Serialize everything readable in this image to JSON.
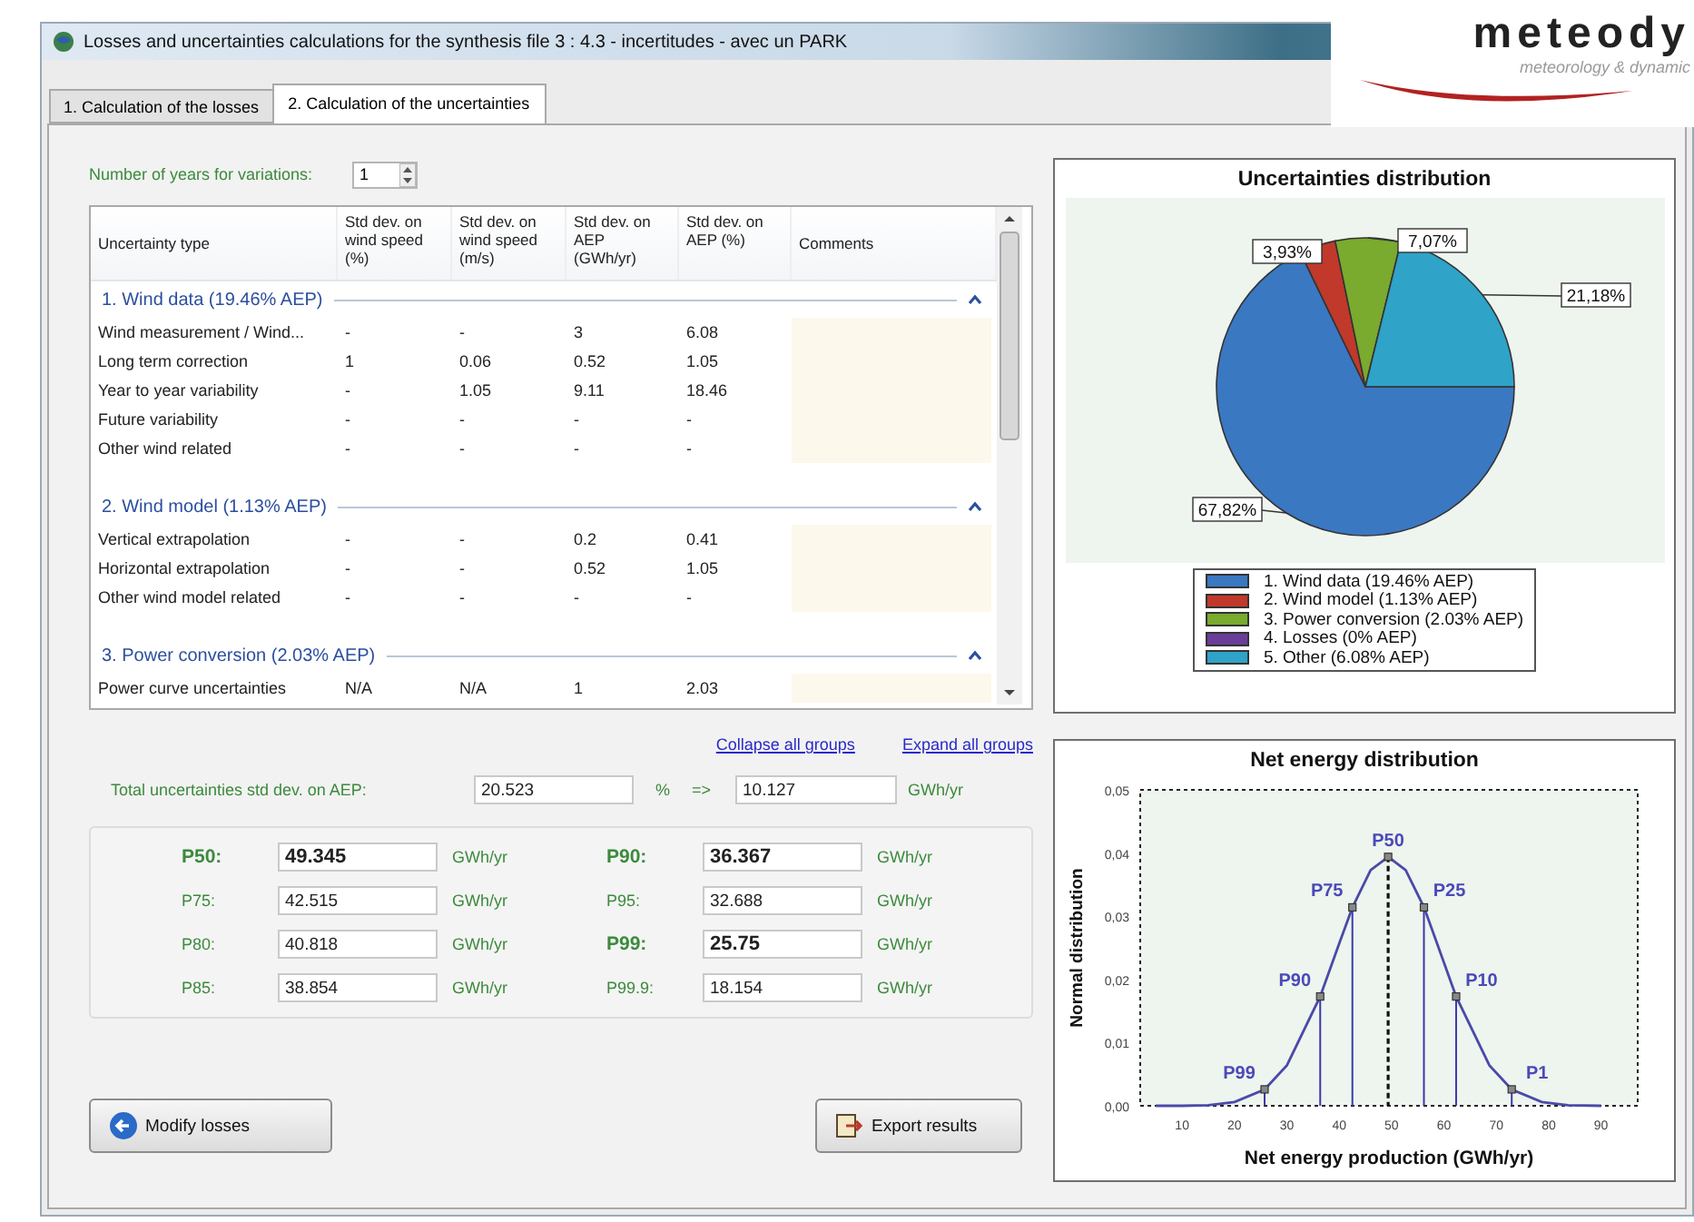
{
  "window": {
    "title": "Losses and uncertainties calculations for the synthesis file 3 : 4.3 - incertitudes - avec un PARK"
  },
  "logo": {
    "name": "meteody",
    "tagline": "meteorology & dynamic"
  },
  "tabs": [
    {
      "label": "1. Calculation of the losses",
      "selected": false
    },
    {
      "label": "2. Calculation of the uncertainties",
      "selected": true
    }
  ],
  "years": {
    "label": "Number of years for variations:",
    "value": "1"
  },
  "table": {
    "columns": [
      "Uncertainty type",
      "Std dev. on wind speed (%)",
      "Std dev. on wind speed (m/s)",
      "Std dev. on AEP (GWh/yr)",
      "Std dev. on AEP (%)",
      "Comments"
    ],
    "groups": [
      {
        "title": "1. Wind data (19.46% AEP)",
        "expanded": true,
        "rows": [
          [
            "Wind measurement / Wind...",
            "-",
            "-",
            "3",
            "6.08"
          ],
          [
            "Long term correction",
            "1",
            "0.06",
            "0.52",
            "1.05"
          ],
          [
            "Year to year variability",
            "-",
            "1.05",
            "9.11",
            "18.46"
          ],
          [
            "Future variability",
            "-",
            "-",
            "-",
            "-"
          ],
          [
            "Other wind related",
            "-",
            "-",
            "-",
            "-"
          ]
        ]
      },
      {
        "title": "2. Wind model (1.13% AEP)",
        "expanded": true,
        "rows": [
          [
            "Vertical extrapolation",
            "-",
            "-",
            "0.2",
            "0.41"
          ],
          [
            "Horizontal extrapolation",
            "-",
            "-",
            "0.52",
            "1.05"
          ],
          [
            "Other wind model related",
            "-",
            "-",
            "-",
            "-"
          ]
        ]
      },
      {
        "title": "3. Power conversion (2.03% AEP)",
        "expanded": true,
        "rows": [
          [
            "Power curve uncertainties",
            "N/A",
            "N/A",
            "1",
            "2.03"
          ]
        ]
      }
    ]
  },
  "links": [
    "Collapse all groups",
    "Expand all groups"
  ],
  "total": {
    "label": "Total uncertainties std dev. on AEP:",
    "percent": "20.523",
    "percent_unit": "%",
    "arrow": "=>",
    "value": "10.127",
    "unit": "GWh/yr"
  },
  "percentiles": [
    {
      "label": "P50:",
      "value": "49.345",
      "unit": "GWh/yr",
      "emphasized": true
    },
    {
      "label": "P90:",
      "value": "36.367",
      "unit": "GWh/yr",
      "emphasized": true
    },
    {
      "label": "P75:",
      "value": "42.515",
      "unit": "GWh/yr",
      "emphasized": false
    },
    {
      "label": "P95:",
      "value": "32.688",
      "unit": "GWh/yr",
      "emphasized": false
    },
    {
      "label": "P80:",
      "value": "40.818",
      "unit": "GWh/yr",
      "emphasized": false
    },
    {
      "label": "P99:",
      "value": "25.75",
      "unit": "GWh/yr",
      "emphasized": true
    },
    {
      "label": "P85:",
      "value": "38.854",
      "unit": "GWh/yr",
      "emphasized": false
    },
    {
      "label": "P99.9:",
      "value": "18.154",
      "unit": "GWh/yr",
      "emphasized": false
    }
  ],
  "buttons": [
    {
      "label": "Modify losses",
      "kind": "back"
    },
    {
      "label": "Export results",
      "kind": "export"
    }
  ],
  "pie_panel": {
    "chart_data": {
      "type": "pie",
      "title": "Uncertainties distribution",
      "categories": [
        "1. Wind data (19.46% AEP)",
        "2. Wind model (1.13% AEP)",
        "3. Power conversion (2.03% AEP)",
        "4. Losses (0% AEP)",
        "5. Other (6.08% AEP)"
      ],
      "values": [
        67.82,
        3.93,
        7.07,
        0,
        21.18
      ],
      "colors": [
        "#3a78c2",
        "#c0392b",
        "#7aaa2e",
        "#6a3d9a",
        "#2fa3c8"
      ],
      "value_labels": [
        "67,82%",
        "3,93%",
        "7,07%",
        null,
        "21,18%"
      ]
    }
  },
  "distribution_panel": {
    "chart_data": {
      "type": "line",
      "title": "Net energy distribution",
      "xlabel": "Net energy production (GWh/yr)",
      "ylabel": "Normal distribution",
      "x": [
        5,
        10,
        15,
        20,
        25.75,
        30,
        36.367,
        40,
        42.515,
        46,
        49.345,
        52.69,
        56.175,
        58.69,
        62.323,
        68.69,
        72.94,
        78.69,
        83.69,
        90
      ],
      "series": [
        {
          "color": "#4a4aa8",
          "values": [
            0,
            0,
            0.0001,
            0.0006,
            0.0026,
            0.0064,
            0.0173,
            0.0257,
            0.0314,
            0.0373,
            0.0394,
            0.0373,
            0.0314,
            0.0257,
            0.0173,
            0.0064,
            0.0026,
            0.0006,
            0.0001,
            0
          ]
        }
      ],
      "xlim": [
        2,
        97
      ],
      "ylim": [
        0,
        0.05
      ],
      "xticks": [
        10,
        20,
        30,
        40,
        50,
        60,
        70,
        80,
        90
      ],
      "yticks": [
        {
          "value": 0,
          "label": "0,00"
        },
        {
          "value": 0.01,
          "label": "0,01"
        },
        {
          "value": 0.02,
          "label": "0,02"
        },
        {
          "value": 0.03,
          "label": "0,03"
        },
        {
          "value": 0.04,
          "label": "0,04"
        },
        {
          "value": 0.05,
          "label": "0,05"
        }
      ],
      "annotations": [
        {
          "x": 25.75,
          "y": 0.0026,
          "text": "P99"
        },
        {
          "x": 36.367,
          "y": 0.0173,
          "text": "P90"
        },
        {
          "x": 42.515,
          "y": 0.0314,
          "text": "P75"
        },
        {
          "x": 49.345,
          "y": 0.0394,
          "text": "P50"
        },
        {
          "x": 56.175,
          "y": 0.0314,
          "text": "P25"
        },
        {
          "x": 62.323,
          "y": 0.0173,
          "text": "P10"
        },
        {
          "x": 72.94,
          "y": 0.0026,
          "text": "P1"
        }
      ]
    }
  }
}
